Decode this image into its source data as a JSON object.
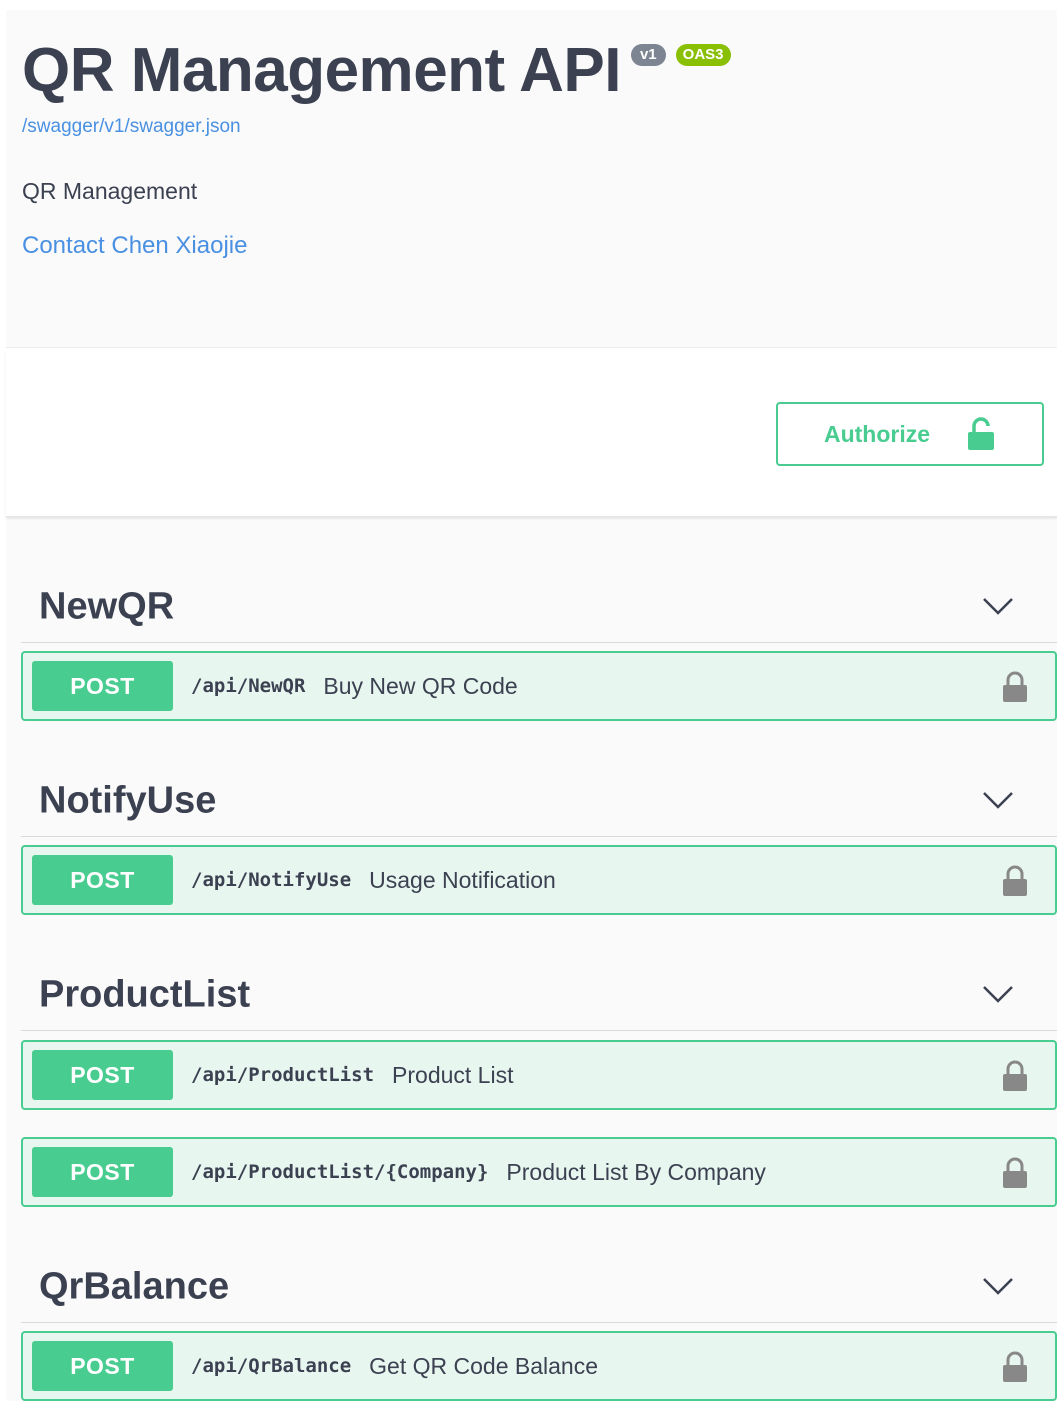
{
  "info": {
    "title": "QR Management API",
    "version_badge": "v1",
    "oas_badge": "OAS3",
    "spec_url": "/swagger/v1/swagger.json",
    "description": "QR Management",
    "contact": "Contact Chen Xiaojie"
  },
  "authorize": {
    "label": "Authorize",
    "icon": "unlocked-padlock-icon"
  },
  "colors": {
    "post": "#49cc90",
    "post_bg": "#e8f6f0",
    "link": "#4990e2",
    "badge_grey": "#7d8492",
    "badge_green": "#89bf04"
  },
  "sections": [
    {
      "title": "NewQR",
      "operations": [
        {
          "method": "POST",
          "path": "/api/NewQR",
          "summary": "Buy New QR Code"
        }
      ]
    },
    {
      "title": "NotifyUse",
      "operations": [
        {
          "method": "POST",
          "path": "/api/NotifyUse",
          "summary": "Usage Notification"
        }
      ]
    },
    {
      "title": "ProductList",
      "operations": [
        {
          "method": "POST",
          "path": "/api/ProductList",
          "summary": "Product List"
        },
        {
          "method": "POST",
          "path": "/api/ProductList/{Company}",
          "summary": "Product List By Company"
        }
      ]
    },
    {
      "title": "QrBalance",
      "operations": [
        {
          "method": "POST",
          "path": "/api/QrBalance",
          "summary": "Get QR Code Balance"
        }
      ]
    }
  ]
}
